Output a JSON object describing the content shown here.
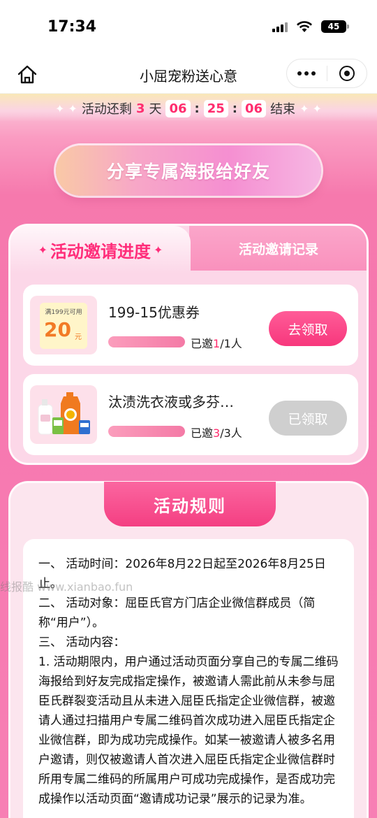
{
  "status_bar": {
    "time": "17:34",
    "battery": "45"
  },
  "nav": {
    "title": "小屈宠粉送心意"
  },
  "countdown": {
    "prefix": "活动还剩",
    "days": "3",
    "days_unit": "天",
    "hours": "06",
    "minutes": "25",
    "seconds": "06",
    "suffix": "结束"
  },
  "share_button": "分享专属海报给好友",
  "tabs": {
    "active": "活动邀请进度",
    "inactive": "活动邀请记录"
  },
  "rewards": [
    {
      "coupon_note": "满199元可用",
      "coupon_value": "20",
      "coupon_unit": "元",
      "name": "199-15优惠券",
      "invited_prefix": "已邀",
      "invited_count": "1",
      "invited_total": "/1人",
      "progress": 1.0,
      "button": "去领取"
    },
    {
      "name": "汰渍洗衣液或多芬…",
      "invited_prefix": "已邀",
      "invited_count": "3",
      "invited_total": "/3人",
      "progress": 1.0,
      "button": "已领取"
    }
  ],
  "rules": {
    "title": "活动规则",
    "lines": [
      "一、 活动时间：2026年8月22日起至2026年8月25日止。",
      "二、 活动对象：屈臣氏官方门店企业微信群成员（简称“用户”）。",
      "三、 活动内容：",
      "1. 活动期限内，用户通过活动页面分享自己的专属二维码海报给到好友完成指定操作，被邀请人需此前从未参与屈臣氏群裂变活动且从未进入屈臣氏指定企业微信群，被邀请人通过扫描用户专属二维码首次成功进入屈臣氏指定企业微信群，即为成功完成操作。如某一被邀请人被多名用户邀请，则仅被邀请人首次进入屈臣氏指定企业微信群时所用专属二维码的所属用户可成功完成操作，是否成功完成操作以活动页面“邀请成功记录”展示的记录为准。"
    ]
  },
  "watermark": "线报酷 www.xianbao.fun",
  "colors": {
    "accent_pink": "#ff2d6e",
    "background_pink": "#f77fb0",
    "button_pink": "#f7377c",
    "disabled_gray": "#cfcfcf"
  }
}
